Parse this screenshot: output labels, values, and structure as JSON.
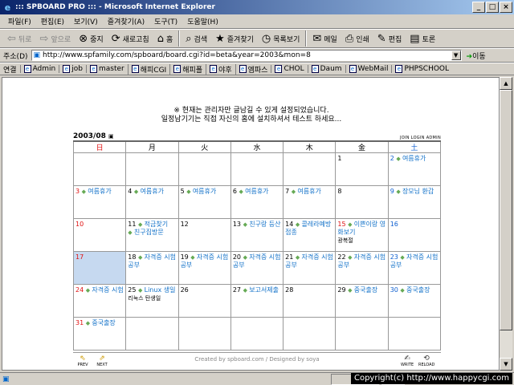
{
  "window": {
    "title": "::: SPBOARD PRO ::: - Microsoft Internet Explorer"
  },
  "menu": [
    "파일(F)",
    "편집(E)",
    "보기(V)",
    "즐겨찾기(A)",
    "도구(T)",
    "도움말(H)"
  ],
  "toolbar": {
    "back": "뒤로",
    "forward": "앞으로",
    "stop": "중지",
    "refresh": "새로고침",
    "home": "홈",
    "search": "검색",
    "favorites": "즐겨찾기",
    "history": "목록보기",
    "mail": "메일",
    "print": "인쇄",
    "edit": "편집",
    "discuss": "토론"
  },
  "address": {
    "label": "주소(D)",
    "url": "http://www.spfamily.com/spboard/board.cgi?id=beta&year=2003&mon=8",
    "go": "이동"
  },
  "links": {
    "label": "연결",
    "items": [
      "Admin",
      "job",
      "master",
      "해피CGI",
      "해피폴",
      "야후",
      "엠파스",
      "CHOL",
      "Daum",
      "WebMail",
      "PHPSCHOOL"
    ]
  },
  "notice": {
    "line1": "※ 현재는 관리자만 글남길 수 있게 설정되었습니다.",
    "line2": "일정남기기는 직접 자신의 홈에 설치하셔서 테스트 하세요..."
  },
  "calendar": {
    "month_label": "2003/08",
    "top_links": "JOIN  LOGIN  ADMIN",
    "weekdays": [
      "日",
      "月",
      "火",
      "水",
      "木",
      "金",
      "土"
    ],
    "cells": [
      {
        "r": 0,
        "c": 5,
        "day": "1",
        "events": []
      },
      {
        "r": 0,
        "c": 6,
        "day": "2",
        "events": [
          "여름휴가"
        ]
      },
      {
        "r": 1,
        "c": 0,
        "day": "3",
        "events": [
          "여름휴가"
        ]
      },
      {
        "r": 1,
        "c": 1,
        "day": "4",
        "events": [
          "여름휴가"
        ]
      },
      {
        "r": 1,
        "c": 2,
        "day": "5",
        "events": [
          "여름휴가"
        ]
      },
      {
        "r": 1,
        "c": 3,
        "day": "6",
        "events": [
          "여름휴가"
        ]
      },
      {
        "r": 1,
        "c": 4,
        "day": "7",
        "events": [
          "여름휴가"
        ]
      },
      {
        "r": 1,
        "c": 5,
        "day": "8",
        "events": []
      },
      {
        "r": 1,
        "c": 6,
        "day": "9",
        "events": [
          "장모님 환갑"
        ]
      },
      {
        "r": 2,
        "c": 0,
        "day": "10",
        "events": []
      },
      {
        "r": 2,
        "c": 1,
        "day": "11",
        "events": [
          "적금찾기",
          "친구집방문"
        ]
      },
      {
        "r": 2,
        "c": 2,
        "day": "12",
        "events": []
      },
      {
        "r": 2,
        "c": 3,
        "day": "13",
        "events": [
          "친구랑 등산"
        ]
      },
      {
        "r": 2,
        "c": 4,
        "day": "14",
        "events": [
          "콜레라예방접종"
        ]
      },
      {
        "r": 2,
        "c": 5,
        "day": "15",
        "events": [
          "이쁜이랑 영화보기"
        ],
        "note": "광복절"
      },
      {
        "r": 2,
        "c": 6,
        "day": "16",
        "events": []
      },
      {
        "r": 3,
        "c": 0,
        "day": "17",
        "events": [],
        "today": true
      },
      {
        "r": 3,
        "c": 1,
        "day": "18",
        "events": [
          "자격증 시험공부"
        ]
      },
      {
        "r": 3,
        "c": 2,
        "day": "19",
        "events": [
          "자격증 시험공부"
        ]
      },
      {
        "r": 3,
        "c": 3,
        "day": "20",
        "events": [
          "자격증 시험공부"
        ]
      },
      {
        "r": 3,
        "c": 4,
        "day": "21",
        "events": [
          "자격증 시험공부"
        ]
      },
      {
        "r": 3,
        "c": 5,
        "day": "22",
        "events": [
          "자격증 시험공부"
        ]
      },
      {
        "r": 3,
        "c": 6,
        "day": "23",
        "events": [
          "자격증 시험공부"
        ]
      },
      {
        "r": 4,
        "c": 0,
        "day": "24",
        "events": [
          "자격증 시험"
        ]
      },
      {
        "r": 4,
        "c": 1,
        "day": "25",
        "events": [
          "Linux 생일"
        ],
        "note": "리눅스 탄생일"
      },
      {
        "r": 4,
        "c": 2,
        "day": "26",
        "events": []
      },
      {
        "r": 4,
        "c": 3,
        "day": "27",
        "events": [
          "보고서제출"
        ]
      },
      {
        "r": 4,
        "c": 4,
        "day": "28",
        "events": []
      },
      {
        "r": 4,
        "c": 5,
        "day": "29",
        "events": [
          "중국출장"
        ]
      },
      {
        "r": 4,
        "c": 6,
        "day": "30",
        "events": [
          "중국출장"
        ]
      },
      {
        "r": 5,
        "c": 0,
        "day": "31",
        "events": [
          "중국출장"
        ]
      }
    ],
    "footer": "Created by spboard.com / Designed by soya",
    "buttons": {
      "prev": "PREV",
      "next": "NEXT",
      "write": "WRITE",
      "reload": "RELOAD"
    }
  },
  "status": {
    "copyright": "Copyright(c) http://www.happycgi.com"
  }
}
